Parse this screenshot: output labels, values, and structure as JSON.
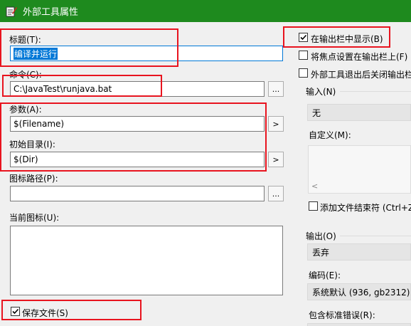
{
  "window": {
    "title": "外部工具属性"
  },
  "left": {
    "title_label": "标题(T):",
    "title_value": "编译并运行",
    "command_label": "命令(C):",
    "command_value": "C:\\JavaTest\\runjava.bat",
    "args_label": "参数(A):",
    "args_value": "$(Filename)",
    "initdir_label": "初始目录(I):",
    "initdir_value": "$(Dir)",
    "iconpath_label": "图标路径(P):",
    "iconpath_value": "",
    "currenticon_label": "当前图标(U):",
    "save_file_label": "保存文件(S)",
    "browse_label": "...",
    "arrow_label": ">"
  },
  "right": {
    "show_in_output_label": "在输出栏中显示(B)",
    "focus_output_label": "将焦点设置在输出栏上(F)",
    "close_on_exit_label": "外部工具退出后关闭输出栏",
    "input_label": "输入(N)",
    "input_value": "无",
    "custom_label": "自定义(M):",
    "add_eof_label": "添加文件结束符 (Ctrl+Z,",
    "output_label": "输出(O)",
    "output_value": "丢弃",
    "encoding_label": "编码(E):",
    "encoding_value": "系统默认 (936, gb2312)",
    "stderr_label": "包含标准错误(R):"
  },
  "checks": {
    "save_file": true,
    "show_in_output": true,
    "focus_output": false,
    "close_on_exit": false,
    "add_eof": false
  },
  "colors": {
    "titlebar": "#1e8a1e",
    "highlight": "#e8141f",
    "selection": "#0078d7"
  }
}
